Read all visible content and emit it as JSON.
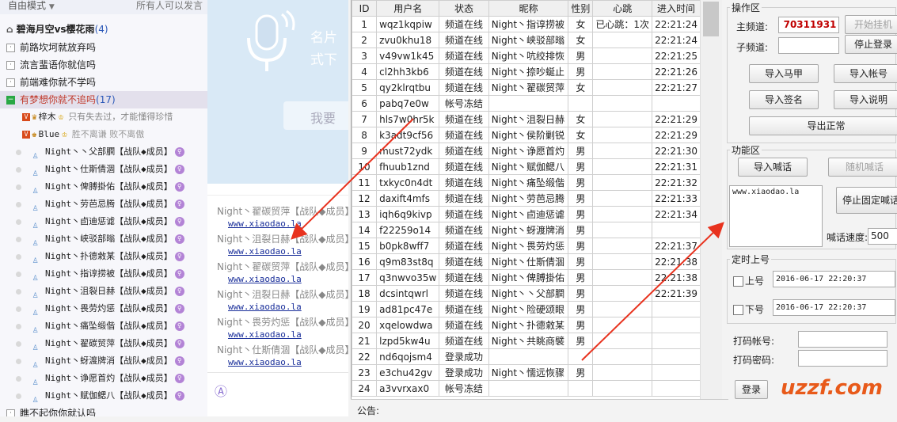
{
  "left_panel": {
    "mode_label": "自由模式",
    "top_right_text": "所有人可以发言",
    "groups": [
      {
        "label": "碧海月空vs樱花雨",
        "count": "(4)"
      },
      {
        "label": "前路坎坷就放弃吗"
      },
      {
        "label": "流言蜚语你就信吗"
      },
      {
        "label": "前端难你就不学吗"
      },
      {
        "label": "有梦想你就不追吗",
        "count": "(17)"
      }
    ],
    "special_members": [
      {
        "name": "梓木",
        "signature": "只有失去过，才能懂得珍惜"
      },
      {
        "name": "Blue",
        "signature": "胜不离谦 败不离傲"
      }
    ],
    "members": [
      "Night丶丶父部膶【战队◆成员】",
      "Night丶仕斯倩涸【战队◆成员】",
      "Night丶俾膊掛佑【战队◆成员】",
      "Night丶劳芭忌腾【战队◆成员】",
      "Night丶卣迪惩谑【战队◆成员】",
      "Night丶峡驳部暡【战队◆成员】",
      "Night丶扑德敹某【战队◆成员】",
      "Night丶指谆捞被【战队◆成员】",
      "Night丶沮裂日赫【战队◆成员】",
      "Night丶畏劳灼惩【战队◆成员】",
      "Night丶痛坠缎偕【战队◆成员】",
      "Night丶翟碳贸萍【战队◆成员】",
      "Night丶蚜渡牌消【战队◆成员】",
      "Night丶诤愿首灼【战队◆成员】",
      "Night丶赋伽鳃八【战队◆成员】"
    ],
    "last_group": "瞧不起你你就认吗"
  },
  "chat": {
    "placeholder_big": "名片\n式下",
    "search_text": "我要",
    "messages": [
      {
        "name": "Night丶翟碳贸萍【战队◆成员】",
        "link": "www.xiaodao.la"
      },
      {
        "name": "Night丶沮裂日赫【战队◆成员】",
        "link": "www.xiaodao.la"
      },
      {
        "name": "Night丶翟碳贸萍【战队◆成员】",
        "link": "www.xiaodao.la"
      },
      {
        "name": "Night丶沮裂日赫【战队◆成员】",
        "link": "www.xiaodao.la"
      },
      {
        "name": "Night丶畏劳灼惩【战队◆成员】",
        "link": "www.xiaodao.la"
      },
      {
        "name": "Night丶仕斯倩涸【战队◆成员】",
        "link": "www.xiaodao.la"
      }
    ]
  },
  "table": {
    "headers": [
      "ID",
      "用户名",
      "状态",
      "昵称",
      "性别",
      "心跳",
      "进入时间"
    ],
    "rows": [
      [
        "1",
        "wqz1kqpiw",
        "频道在线",
        "Night丶指谆捞被",
        "女",
        "已心跳：1次",
        "22:21:24"
      ],
      [
        "2",
        "zvu0khu18",
        "频道在线",
        "Night丶峡驳部暡",
        "女",
        "",
        "22:21:24"
      ],
      [
        "3",
        "v49vw1k45",
        "频道在线",
        "Night丶吭绞排恢",
        "男",
        "",
        "22:21:25"
      ],
      [
        "4",
        "cl2hh3kb6",
        "频道在线",
        "Night丶捺吵蜒止",
        "男",
        "",
        "22:21:26"
      ],
      [
        "5",
        "qy2klrqtbu",
        "频道在线",
        "Night丶翟碳贸萍",
        "女",
        "",
        "22:21:27"
      ],
      [
        "6",
        "pabq7e0w",
        "帐号冻结",
        "",
        "",
        "",
        ""
      ],
      [
        "7",
        "hls7w0hr5k",
        "频道在线",
        "Night丶沮裂日赫",
        "女",
        "",
        "22:21:29"
      ],
      [
        "8",
        "k3adt9cf56",
        "频道在线",
        "Night丶侯阶剿锐",
        "女",
        "",
        "22:21:29"
      ],
      [
        "9",
        "must72ydk",
        "频道在线",
        "Night丶诤愿首灼",
        "男",
        "",
        "22:21:30"
      ],
      [
        "10",
        "fhuub1znd",
        "频道在线",
        "Night丶赋伽鳃八",
        "男",
        "",
        "22:21:31"
      ],
      [
        "11",
        "txkyc0n4dt",
        "频道在线",
        "Night丶痛坠缎偕",
        "男",
        "",
        "22:21:32"
      ],
      [
        "12",
        "daxift4mfs",
        "频道在线",
        "Night丶劳芭忌腾",
        "男",
        "",
        "22:21:33"
      ],
      [
        "13",
        "iqh6q9kivp",
        "频道在线",
        "Night丶卣迪惩谑",
        "男",
        "",
        "22:21:34"
      ],
      [
        "14",
        "f22259o14",
        "频道在线",
        "Night丶蚜渡牌消",
        "男",
        "",
        ""
      ],
      [
        "15",
        "b0pk8wff7",
        "频道在线",
        "Night丶畏劳灼惩",
        "男",
        "",
        "22:21:37"
      ],
      [
        "16",
        "q9m83st8q",
        "频道在线",
        "Night丶仕斯倩涸",
        "男",
        "",
        "22:21:38"
      ],
      [
        "17",
        "q3nwvo35w",
        "频道在线",
        "Night丶俾膊掛佑",
        "男",
        "",
        "22:21:38"
      ],
      [
        "18",
        "dcsintqwrl",
        "频道在线",
        "Night丶丶父部膶",
        "男",
        "",
        "22:21:39"
      ],
      [
        "19",
        "ad81pc47e",
        "频道在线",
        "Night丶险硬颂眼",
        "男",
        "",
        ""
      ],
      [
        "20",
        "xqelowdwa",
        "频道在线",
        "Night丶扑德敹某",
        "男",
        "",
        ""
      ],
      [
        "21",
        "lzpd5kw4u",
        "频道在线",
        "Night丶共眺商襞",
        "男",
        "",
        ""
      ],
      [
        "22",
        "nd6qojsm4",
        "登录成功",
        "",
        "",
        "",
        ""
      ],
      [
        "23",
        "e3chu42gv",
        "登录成功",
        "Night丶懦远恢骤",
        "男",
        "",
        ""
      ],
      [
        "24",
        "a3vvrxax0",
        "帐号冻结",
        "",
        "",
        "",
        ""
      ]
    ]
  },
  "controls": {
    "operation_title": "操作区",
    "main_channel_label": "主频道:",
    "main_channel_value": "70311931",
    "sub_channel_label": "子频道:",
    "sub_channel_value": "",
    "start_hang_label": "开始挂机",
    "stop_login_label": "停止登录",
    "import_vest": "导入马甲",
    "import_account": "导入帐号",
    "import_sign": "导入签名",
    "import_desc": "导入说明",
    "export_normal": "导出正常",
    "function_title": "功能区",
    "import_shout": "导入喊话",
    "random_shout": "随机喊话",
    "shout_text": "www.xiaodao.la",
    "stop_fixed_shout": "停止固定喊话",
    "shout_speed_label": "喊话速度:",
    "shout_speed_value": "500",
    "timer_title": "定时上号",
    "on_label": "上号",
    "on_time": "2016-06-17 22:20:37",
    "off_label": "下号",
    "off_time": "2016-06-17 22:20:37",
    "captcha_account_label": "打码帐号:",
    "captcha_password_label": "打码密码:",
    "login_label": "登录"
  },
  "notice_label": "公告:",
  "watermark": "uzzf.com",
  "colors": {
    "channel_value": "#c00000",
    "arrow": "#e8321e",
    "group_active": "#c0392b",
    "link": "#1a2f9a"
  }
}
